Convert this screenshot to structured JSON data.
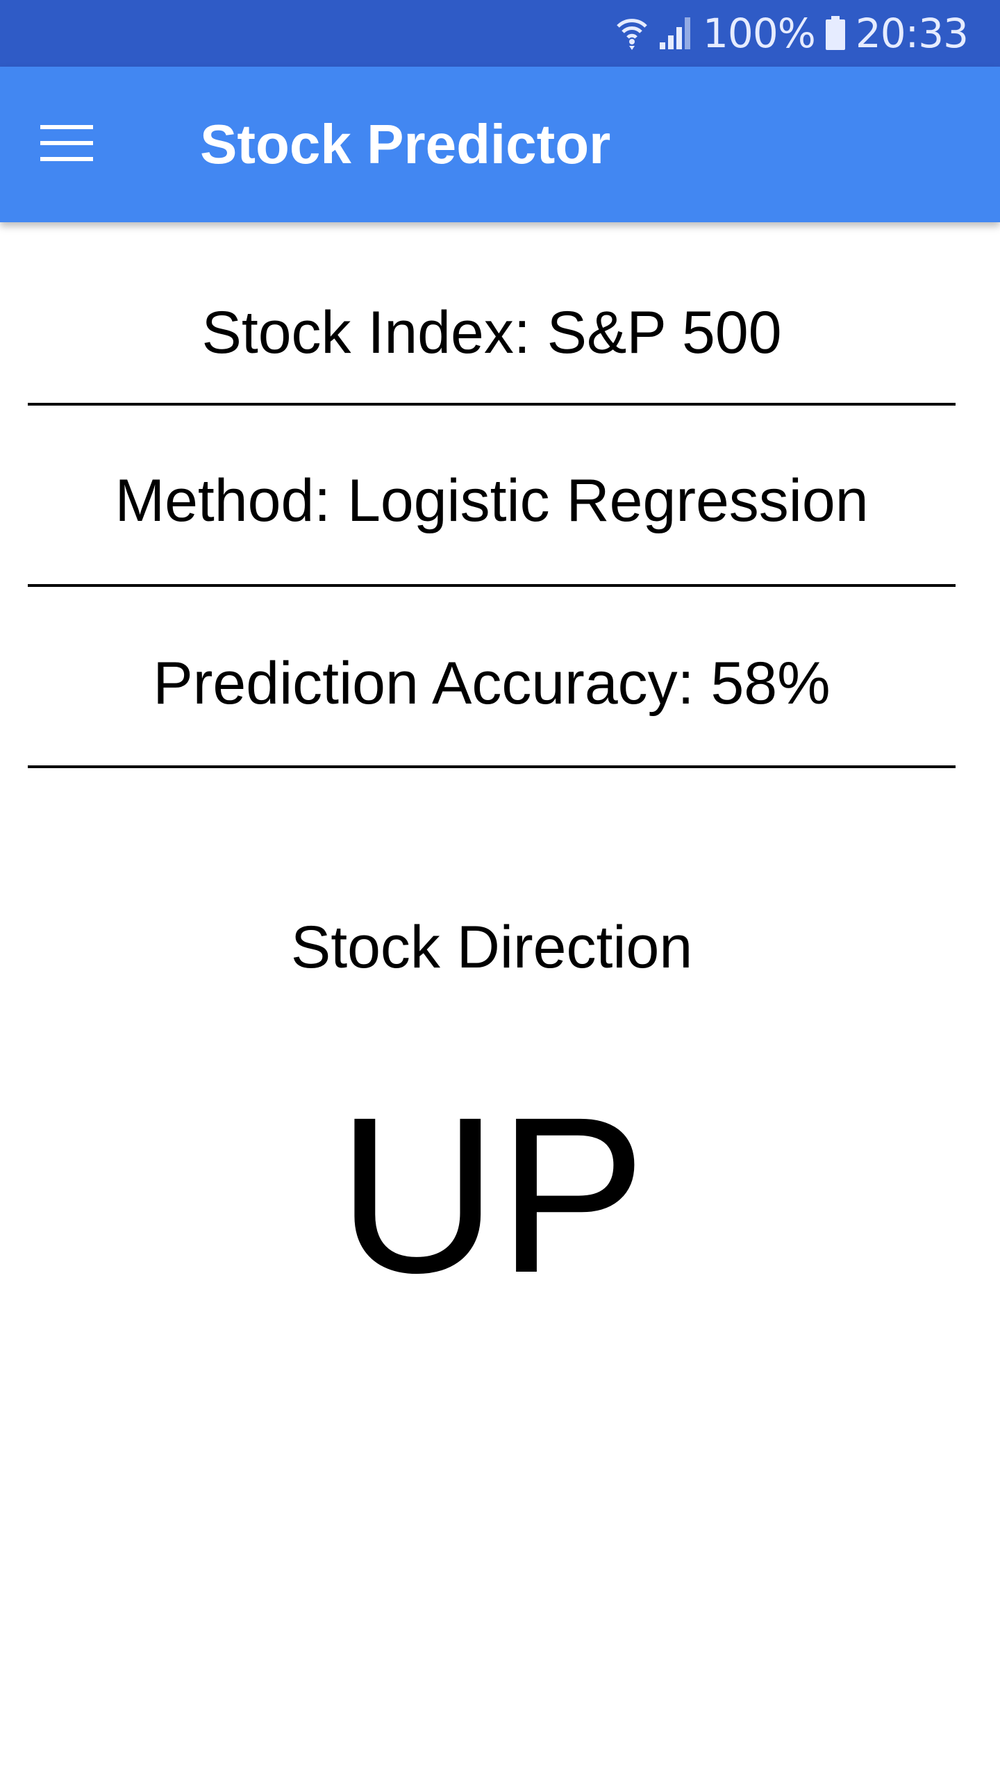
{
  "status_bar": {
    "battery_percent": "100%",
    "time": "20:33",
    "icons": [
      "wifi-icon",
      "signal-icon",
      "battery-icon"
    ],
    "color": "#2f5bc6"
  },
  "app_bar": {
    "title": "Stock Predictor",
    "menu_icon": "menu-icon",
    "color": "#4287f2"
  },
  "info": {
    "stock_index": "Stock Index: S&P 500",
    "method": "Method: Logistic Regression",
    "accuracy": "Prediction Accuracy: 58%"
  },
  "prediction": {
    "label": "Stock Direction",
    "value": "UP"
  }
}
